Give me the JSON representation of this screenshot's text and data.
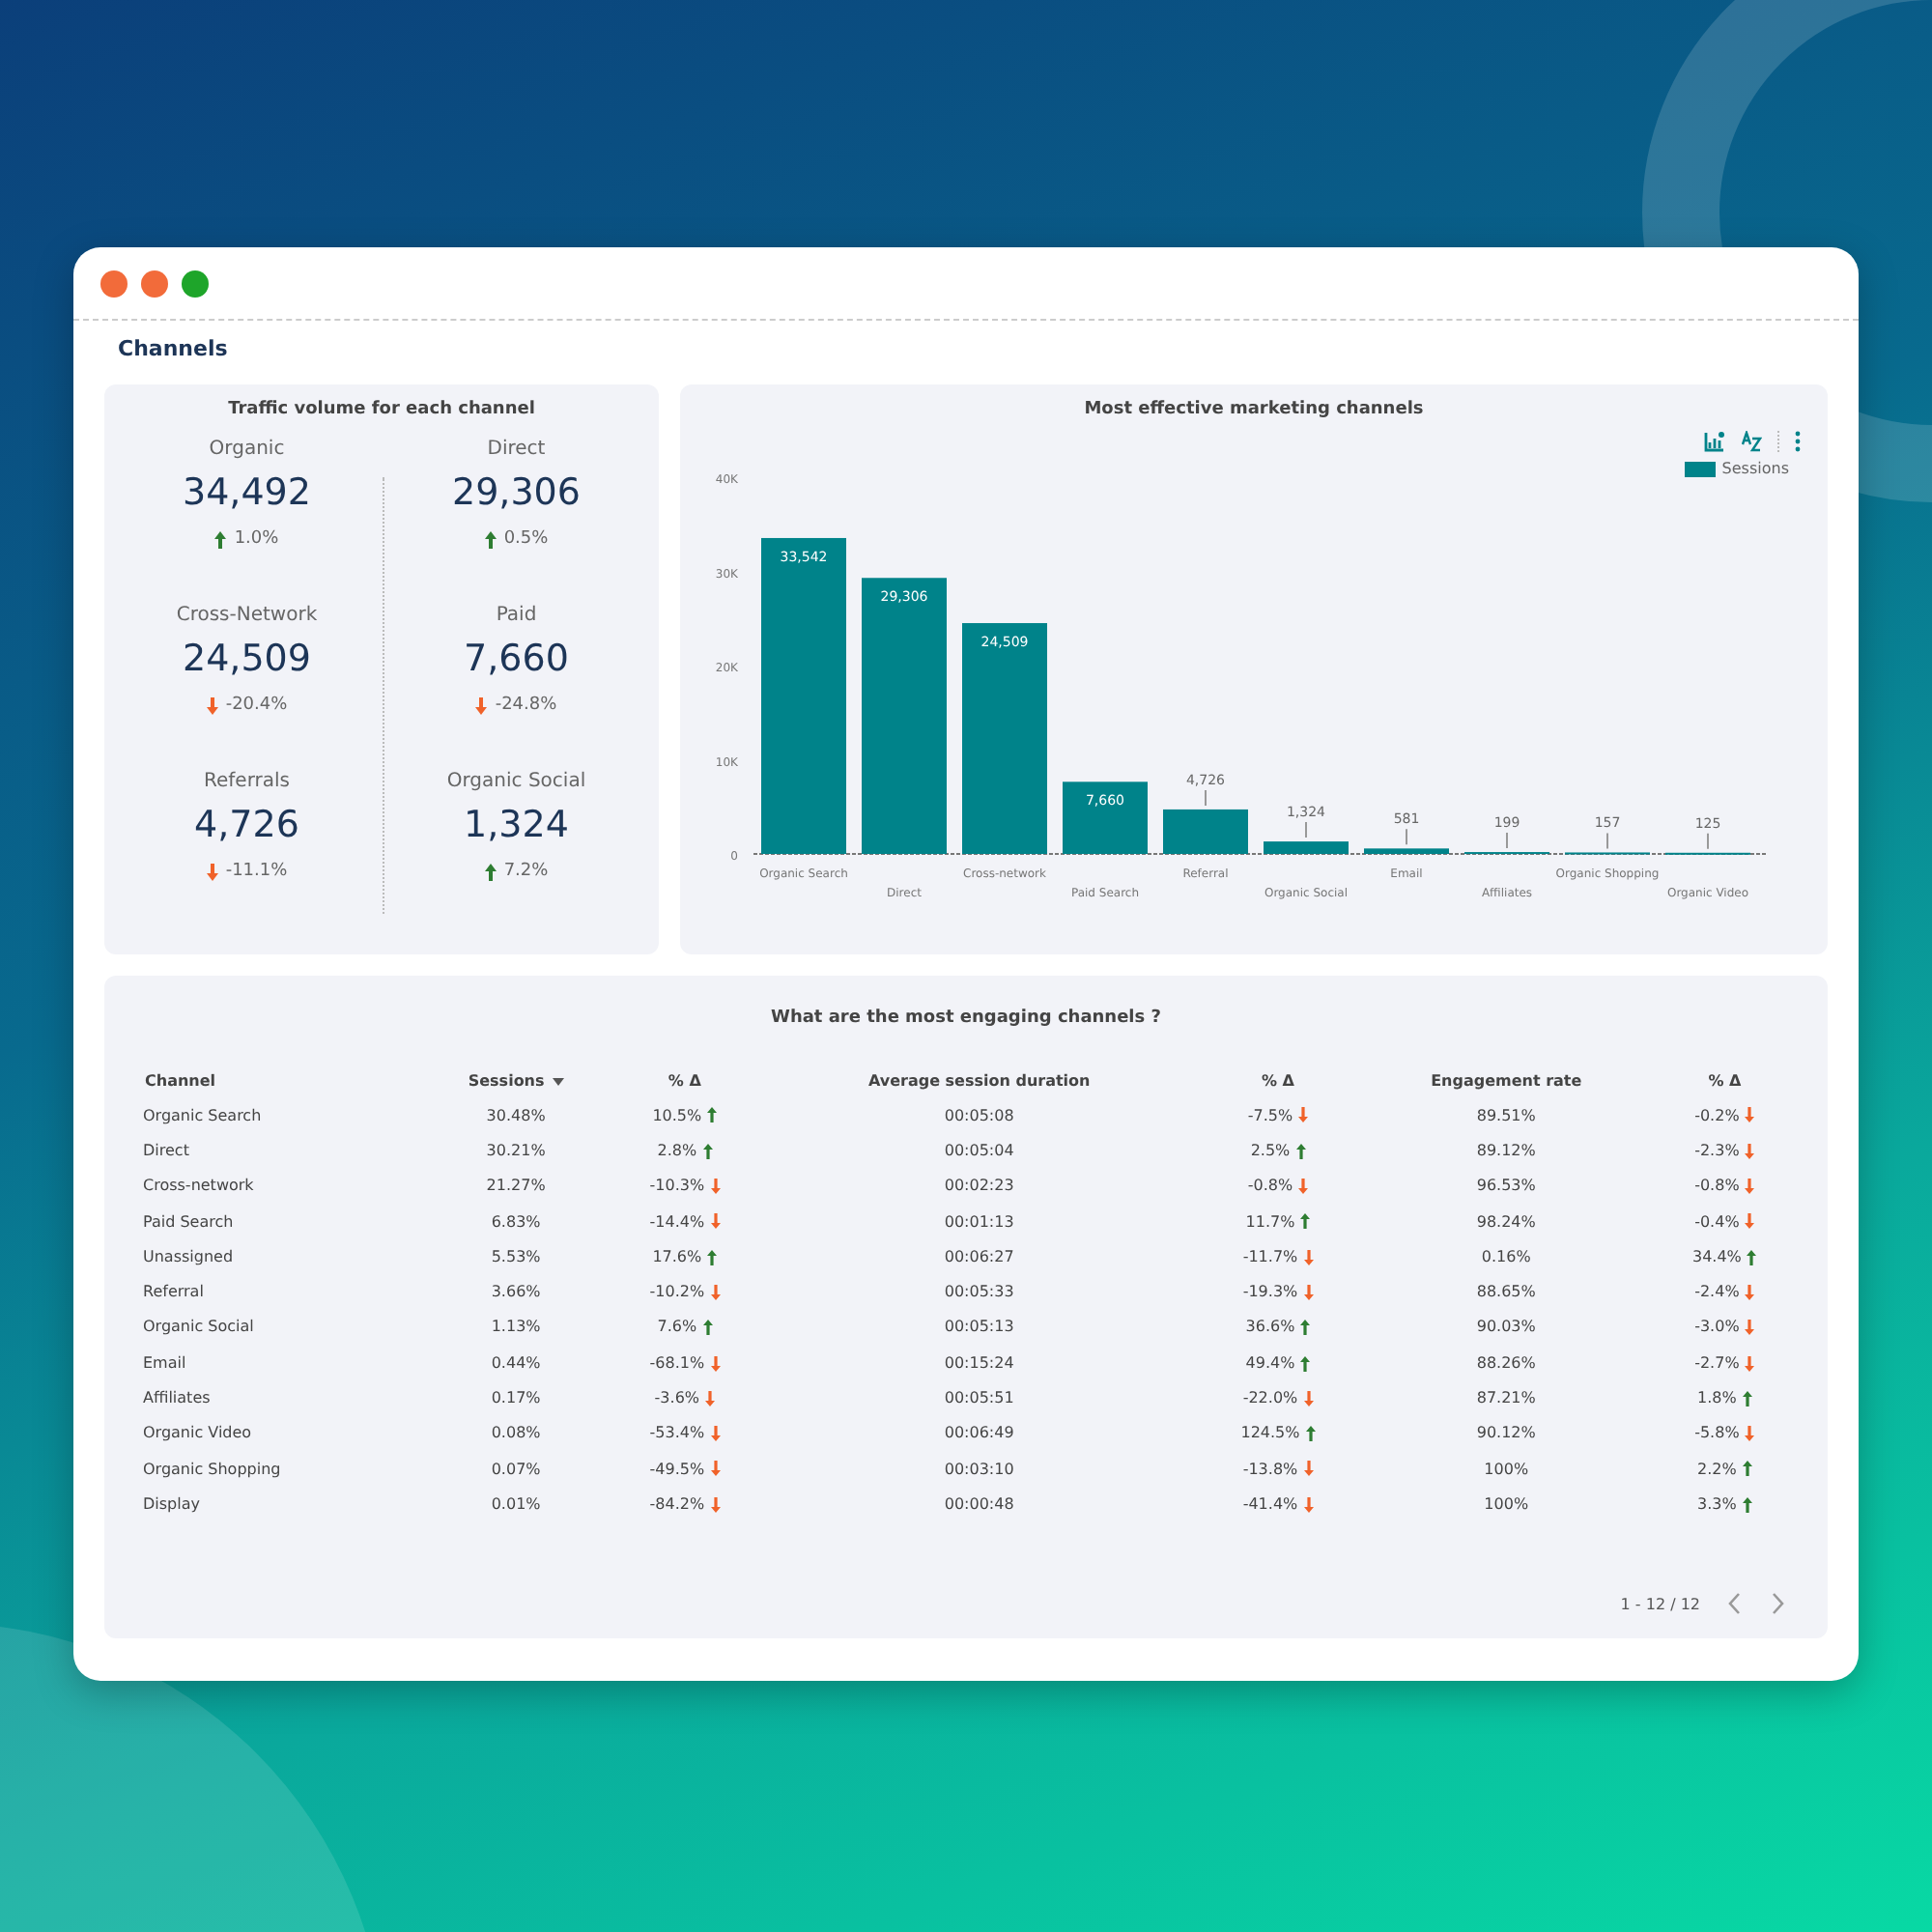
{
  "window": {
    "title": "Channels"
  },
  "traffic": {
    "title": "Traffic volume for each channel",
    "stats": [
      {
        "label": "Organic",
        "value": "34,492",
        "delta": "1.0%",
        "rising": true
      },
      {
        "label": "Direct",
        "value": "29,306",
        "delta": "0.5%",
        "rising": true
      },
      {
        "label": "Cross-Network",
        "value": "24,509",
        "delta": "-20.4%",
        "rising": false
      },
      {
        "label": "Paid",
        "value": "7,660",
        "delta": "-24.8%",
        "rising": false
      },
      {
        "label": "Referrals",
        "value": "4,726",
        "delta": "-11.1%",
        "rising": false
      },
      {
        "label": "Organic Social",
        "value": "1,324",
        "delta": "7.2%",
        "rising": true
      }
    ]
  },
  "chart": {
    "title": "Most effective marketing channels",
    "chart_data": {
      "type": "bar",
      "categories": [
        "Organic Search",
        "Direct",
        "Cross-network",
        "Paid Search",
        "Referral",
        "Organic Social",
        "Email",
        "Affiliates",
        "Organic Shopping",
        "Organic Video"
      ],
      "series": [
        {
          "name": "Sessions",
          "color": "#00838a",
          "values": [
            33542,
            29306,
            24509,
            7660,
            4726,
            1324,
            581,
            199,
            157,
            125
          ]
        }
      ],
      "value_labels": [
        "33,542",
        "29,306",
        "24,509",
        "7,660",
        "4,726",
        "1,324",
        "581",
        "199",
        "157",
        "125"
      ],
      "ylim": [
        0,
        40000
      ],
      "yticks": [
        {
          "value": 0,
          "label": "0"
        },
        {
          "value": 10000,
          "label": "10K"
        },
        {
          "value": 20000,
          "label": "20K"
        },
        {
          "value": 30000,
          "label": "30K"
        },
        {
          "value": 40000,
          "label": "40K"
        }
      ]
    }
  },
  "table": {
    "title": "What are the most engaging channels ?",
    "columns": [
      {
        "label": "Channel",
        "sorted": false
      },
      {
        "label": "Sessions",
        "sorted": true
      },
      {
        "label": "% Δ",
        "sorted": false
      },
      {
        "label": "Average session duration",
        "sorted": false
      },
      {
        "label": "% Δ",
        "sorted": false
      },
      {
        "label": "Engagement rate",
        "sorted": false
      },
      {
        "label": "% Δ",
        "sorted": false
      }
    ],
    "rows": [
      {
        "channel": "Organic Search",
        "sessions": "30.48%",
        "sessions_delta": {
          "text": "10.5%",
          "rising": true
        },
        "duration": "00:05:08",
        "duration_delta": {
          "text": "-7.5%",
          "rising": false
        },
        "engagement": "89.51%",
        "engagement_delta": {
          "text": "-0.2%",
          "rising": false
        }
      },
      {
        "channel": "Direct",
        "sessions": "30.21%",
        "sessions_delta": {
          "text": "2.8%",
          "rising": true
        },
        "duration": "00:05:04",
        "duration_delta": {
          "text": "2.5%",
          "rising": true
        },
        "engagement": "89.12%",
        "engagement_delta": {
          "text": "-2.3%",
          "rising": false
        }
      },
      {
        "channel": "Cross-network",
        "sessions": "21.27%",
        "sessions_delta": {
          "text": "-10.3%",
          "rising": false
        },
        "duration": "00:02:23",
        "duration_delta": {
          "text": "-0.8%",
          "rising": false
        },
        "engagement": "96.53%",
        "engagement_delta": {
          "text": "-0.8%",
          "rising": false
        }
      },
      {
        "channel": "Paid Search",
        "sessions": "6.83%",
        "sessions_delta": {
          "text": "-14.4%",
          "rising": false
        },
        "duration": "00:01:13",
        "duration_delta": {
          "text": "11.7%",
          "rising": true
        },
        "engagement": "98.24%",
        "engagement_delta": {
          "text": "-0.4%",
          "rising": false
        }
      },
      {
        "channel": "Unassigned",
        "sessions": "5.53%",
        "sessions_delta": {
          "text": "17.6%",
          "rising": true
        },
        "duration": "00:06:27",
        "duration_delta": {
          "text": "-11.7%",
          "rising": false
        },
        "engagement": "0.16%",
        "engagement_delta": {
          "text": "34.4%",
          "rising": true
        }
      },
      {
        "channel": "Referral",
        "sessions": "3.66%",
        "sessions_delta": {
          "text": "-10.2%",
          "rising": false
        },
        "duration": "00:05:33",
        "duration_delta": {
          "text": "-19.3%",
          "rising": false
        },
        "engagement": "88.65%",
        "engagement_delta": {
          "text": "-2.4%",
          "rising": false
        }
      },
      {
        "channel": "Organic Social",
        "sessions": "1.13%",
        "sessions_delta": {
          "text": "7.6%",
          "rising": true
        },
        "duration": "00:05:13",
        "duration_delta": {
          "text": "36.6%",
          "rising": true
        },
        "engagement": "90.03%",
        "engagement_delta": {
          "text": "-3.0%",
          "rising": false
        }
      },
      {
        "channel": "Email",
        "sessions": "0.44%",
        "sessions_delta": {
          "text": "-68.1%",
          "rising": false
        },
        "duration": "00:15:24",
        "duration_delta": {
          "text": "49.4%",
          "rising": true
        },
        "engagement": "88.26%",
        "engagement_delta": {
          "text": "-2.7%",
          "rising": false
        }
      },
      {
        "channel": "Affiliates",
        "sessions": "0.17%",
        "sessions_delta": {
          "text": "-3.6%",
          "rising": false
        },
        "duration": "00:05:51",
        "duration_delta": {
          "text": "-22.0%",
          "rising": false
        },
        "engagement": "87.21%",
        "engagement_delta": {
          "text": "1.8%",
          "rising": true
        }
      },
      {
        "channel": "Organic Video",
        "sessions": "0.08%",
        "sessions_delta": {
          "text": "-53.4%",
          "rising": false
        },
        "duration": "00:06:49",
        "duration_delta": {
          "text": "124.5%",
          "rising": true
        },
        "engagement": "90.12%",
        "engagement_delta": {
          "text": "-5.8%",
          "rising": false
        }
      },
      {
        "channel": "Organic Shopping",
        "sessions": "0.07%",
        "sessions_delta": {
          "text": "-49.5%",
          "rising": false
        },
        "duration": "00:03:10",
        "duration_delta": {
          "text": "-13.8%",
          "rising": false
        },
        "engagement": "100%",
        "engagement_delta": {
          "text": "2.2%",
          "rising": true
        }
      },
      {
        "channel": "Display",
        "sessions": "0.01%",
        "sessions_delta": {
          "text": "-84.2%",
          "rising": false
        },
        "duration": "00:00:48",
        "duration_delta": {
          "text": "-41.4%",
          "rising": false
        },
        "engagement": "100%",
        "engagement_delta": {
          "text": "3.3%",
          "rising": true
        }
      }
    ],
    "pagination": "1 - 12 / 12"
  }
}
